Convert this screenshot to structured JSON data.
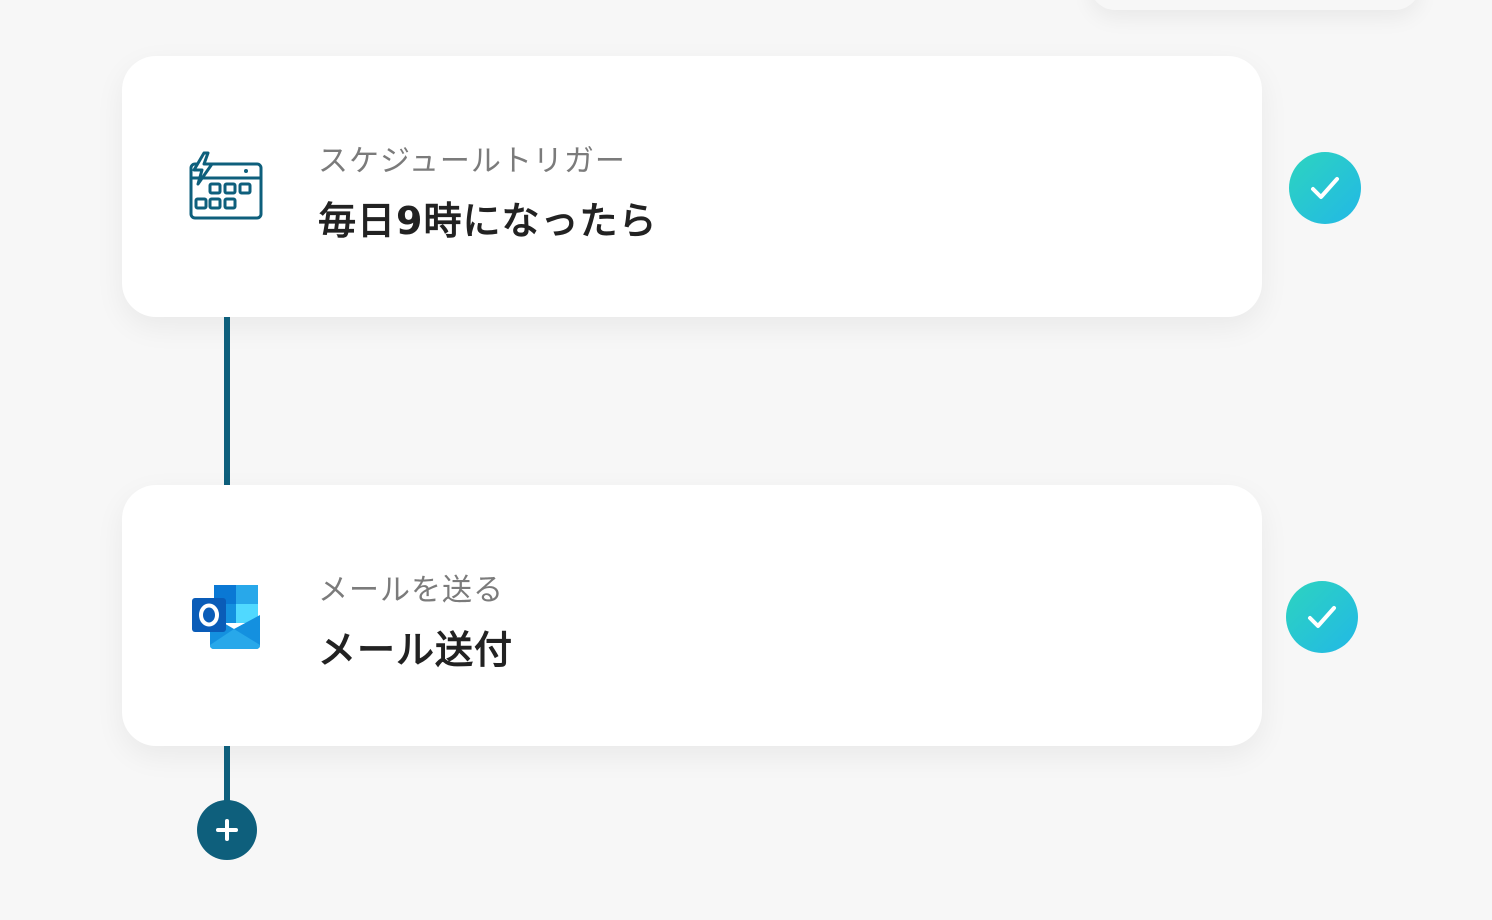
{
  "flow": {
    "steps": [
      {
        "subtitle": "スケジュールトリガー",
        "title": "毎日9時になったら",
        "icon": "schedule-calendar-lightning-icon",
        "status_icon": "check-icon"
      },
      {
        "subtitle": "メールを送る",
        "title": "メール送付",
        "icon": "outlook-icon",
        "status_icon": "check-icon"
      }
    ],
    "add_button_icon": "plus-icon"
  },
  "colors": {
    "background": "#f7f7f7",
    "card": "#ffffff",
    "connector": "#0e5f7c",
    "check_gradient_start": "#2dd4bf",
    "check_gradient_end": "#22b8e6",
    "subtitle_text": "#7b7b7b",
    "title_text": "#222222"
  }
}
